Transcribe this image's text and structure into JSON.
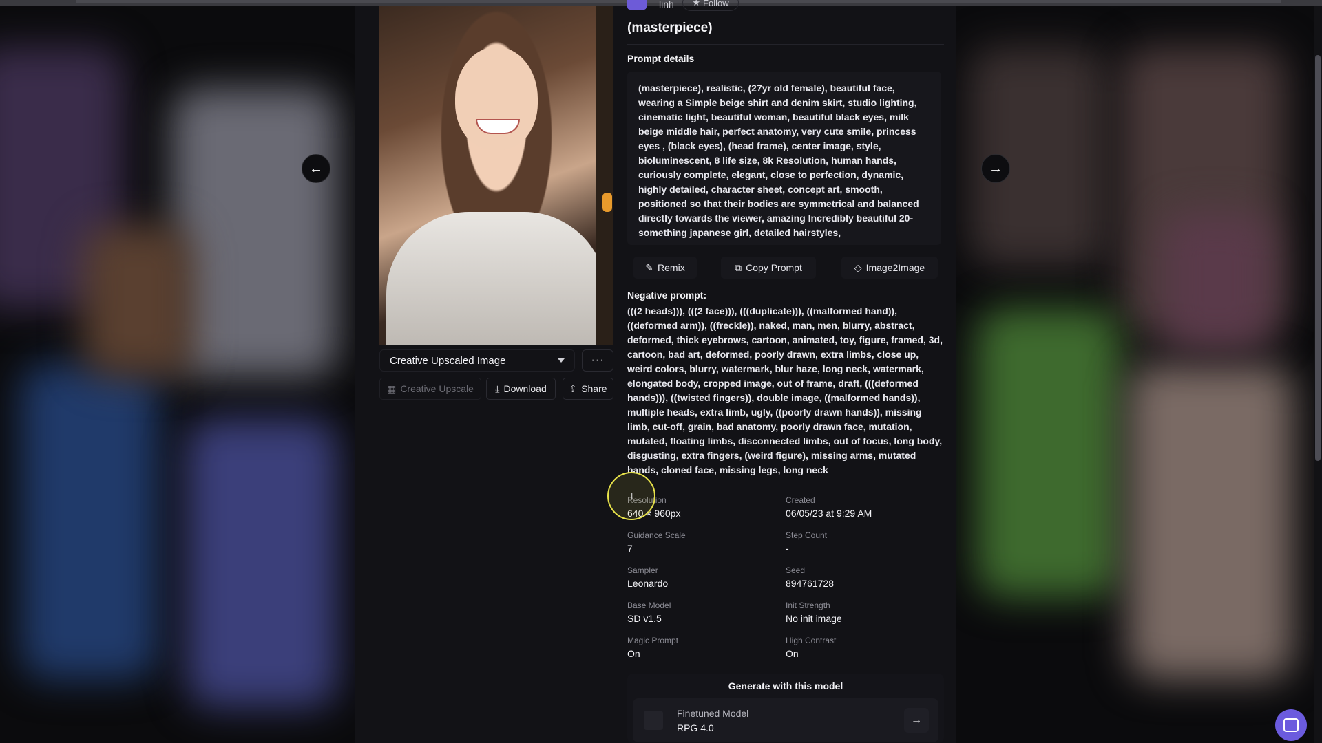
{
  "creator": {
    "name": "linh",
    "follow_label": "Follow"
  },
  "title": "(masterpiece)",
  "prompt_details": {
    "label": "Prompt details",
    "text": "(masterpiece), realistic, (27yr old female), beautiful face, wearing a Simple beige shirt and denim skirt, studio lighting, cinematic light, beautiful woman, beautiful black eyes, milk beige middle hair, perfect anatomy, very cute smile, princess eyes , (black eyes), (head frame), center image, style, bioluminescent, 8 life size, 8k Resolution, human hands, curiously complete, elegant, close to perfection, dynamic, highly detailed, character sheet, concept art, smooth, positioned so that their bodies are symmetrical and balanced directly towards the viewer, amazing Incredibly beautiful 20-something japanese girl, detailed hairstyles,"
  },
  "prompt_actions": {
    "remix": "Remix",
    "copy_prompt": "Copy Prompt",
    "image2image": "Image2Image"
  },
  "negative_prompt": {
    "label": "Negative prompt:",
    "text": "(((2 heads))), (((2 face))), (((duplicate))), ((malformed hand)), ((deformed arm)), ((freckle)), naked, man, men, blurry, abstract, deformed, thick eyebrows, cartoon, animated, toy, figure, framed, 3d, cartoon, bad art, deformed, poorly drawn, extra limbs, close up, weird colors, blurry, watermark, blur haze, long neck, watermark, elongated body, cropped image, out of frame, draft, (((deformed hands))), ((twisted fingers)), double image, ((malformed hands)), multiple heads, extra limb, ugly, ((poorly drawn hands)), missing limb, cut-off, grain, bad anatomy, poorly drawn face, mutation, mutated, floating limbs, disconnected limbs, out of focus, long body, disgusting, extra fingers, (weird figure), missing arms, mutated hands, cloned face, missing legs, long neck"
  },
  "image_panel": {
    "select_value": "Creative Upscaled Image",
    "more_label": "···",
    "creative_upscale": "Creative Upscale",
    "download": "Download",
    "share": "Share"
  },
  "meta": {
    "resolution_k": "Resolution",
    "resolution_v": "640 × 960px",
    "created_k": "Created",
    "created_v": "06/05/23 at 9:29 AM",
    "guidance_k": "Guidance Scale",
    "guidance_v": "7",
    "step_k": "Step Count",
    "step_v": "-",
    "sampler_k": "Sampler",
    "sampler_v": "Leonardo",
    "seed_k": "Seed",
    "seed_v": "894761728",
    "base_k": "Base Model",
    "base_v": "SD v1.5",
    "init_k": "Init Strength",
    "init_v": "No init image",
    "magic_k": "Magic Prompt",
    "magic_v": "On",
    "contrast_k": "High Contrast",
    "contrast_v": "On"
  },
  "generate": {
    "title": "Generate with this model",
    "model_label": "Finetuned Model",
    "model_name": "RPG 4.0"
  },
  "icons": {
    "prev": "arrow-left-icon",
    "next": "arrow-right-icon",
    "chat": "chat-icon"
  },
  "colors": {
    "accent": "#6b5bde",
    "cursor_highlight": "#e7e24a"
  }
}
